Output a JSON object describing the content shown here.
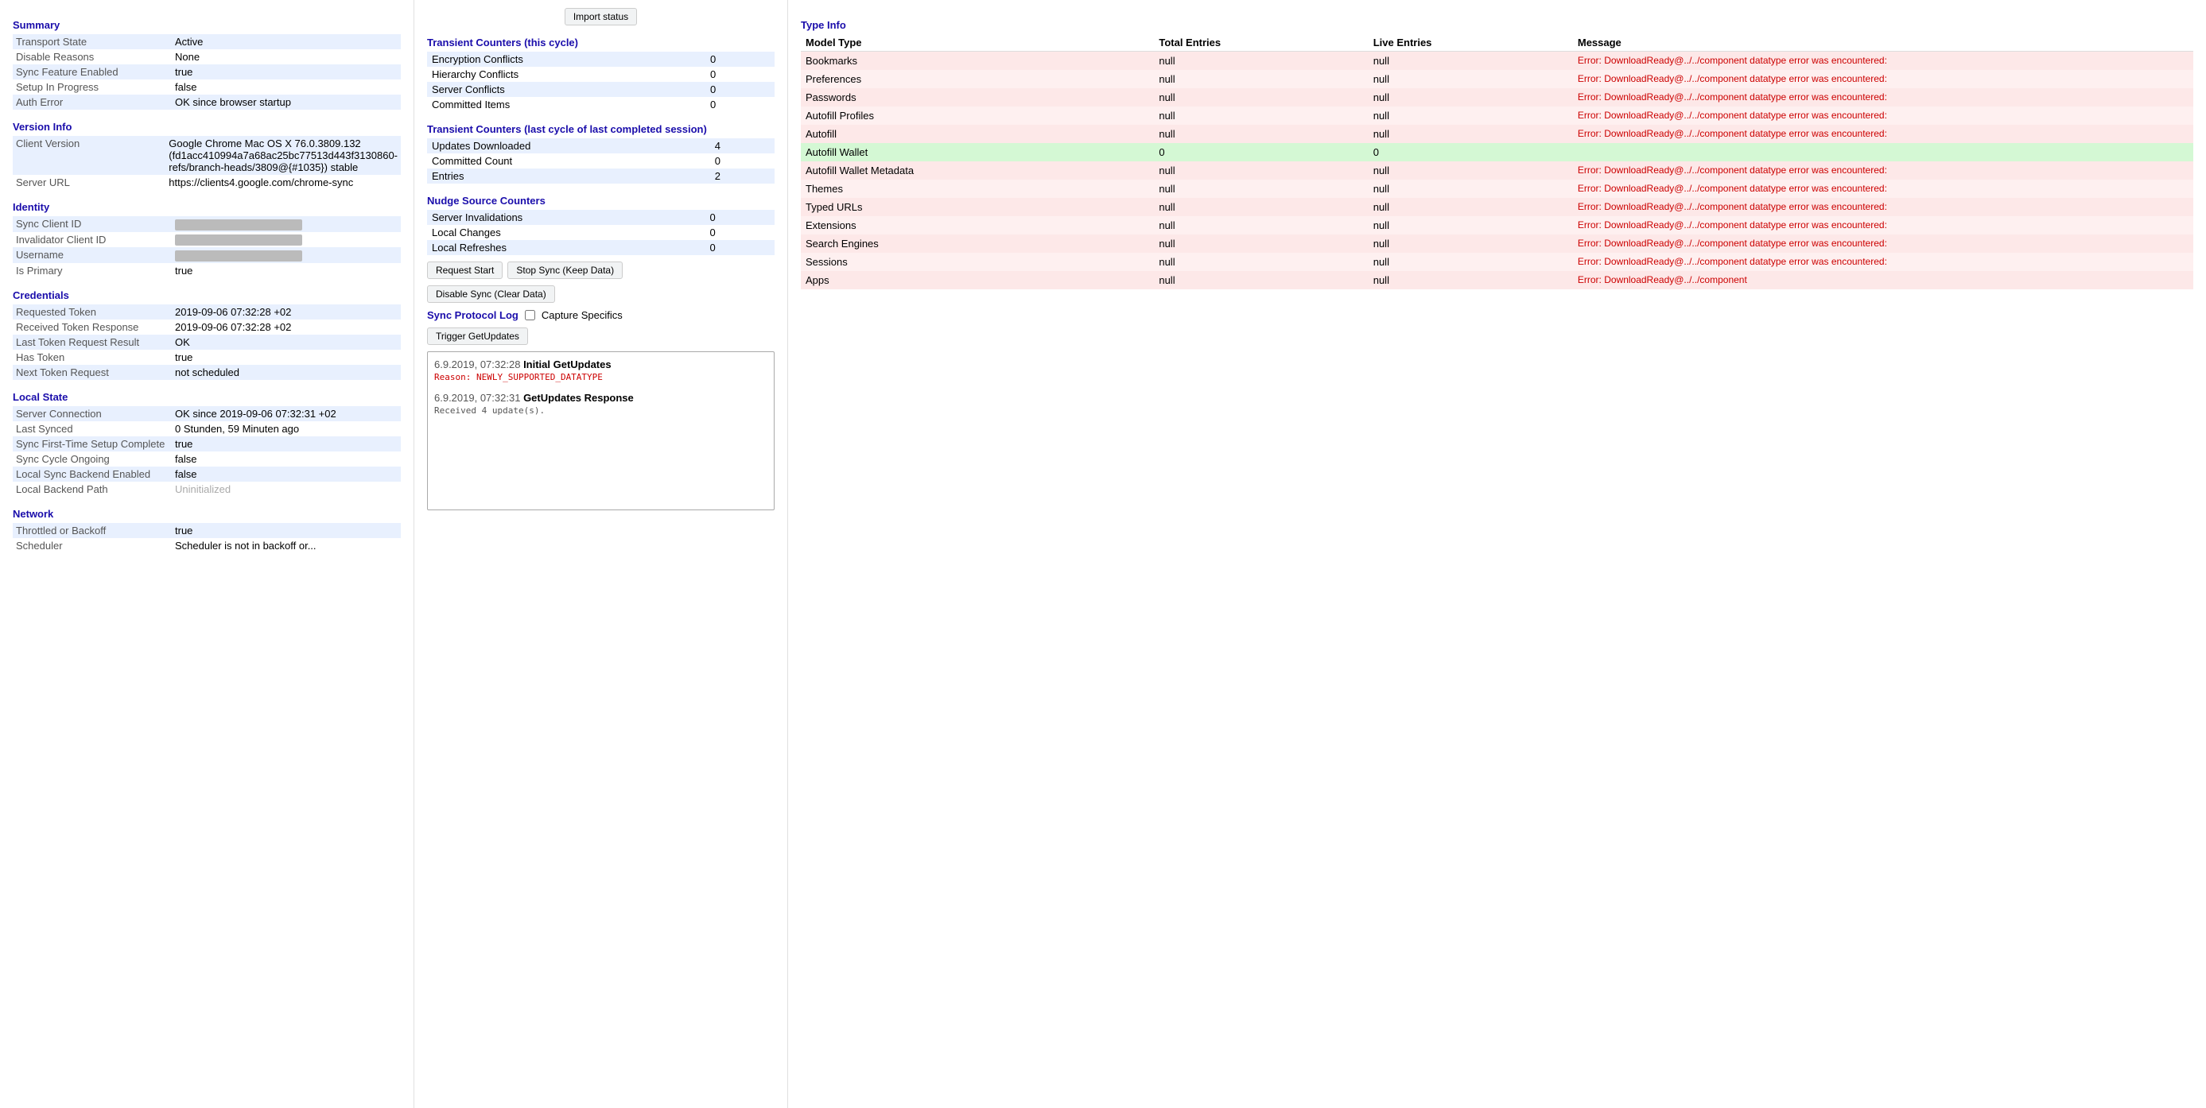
{
  "import_status_btn": "Import status",
  "left": {
    "summary": {
      "title": "Summary",
      "rows": [
        {
          "label": "Transport State",
          "value": "Active"
        },
        {
          "label": "Disable Reasons",
          "value": "None"
        },
        {
          "label": "Sync Feature Enabled",
          "value": "true"
        },
        {
          "label": "Setup In Progress",
          "value": "false"
        },
        {
          "label": "Auth Error",
          "value": "OK since browser startup"
        }
      ]
    },
    "version_info": {
      "title": "Version Info",
      "rows": [
        {
          "label": "Client Version",
          "value": "Google Chrome Mac OS X 76.0.3809.132 (fd1acc410994a7a68ac25bc77513d443f3130860-refs/branch-heads/3809@{#1035}) stable"
        },
        {
          "label": "Server URL",
          "value": "https://clients4.google.com/chrome-sync"
        }
      ]
    },
    "identity": {
      "title": "Identity",
      "rows": [
        {
          "label": "Sync Client ID",
          "value": "BLURRED"
        },
        {
          "label": "Invalidator Client ID",
          "value": "BLURRED"
        },
        {
          "label": "Username",
          "value": "BLURRED"
        },
        {
          "label": "Is Primary",
          "value": "true"
        }
      ]
    },
    "credentials": {
      "title": "Credentials",
      "rows": [
        {
          "label": "Requested Token",
          "value": "2019-09-06 07:32:28 +02"
        },
        {
          "label": "Received Token Response",
          "value": "2019-09-06 07:32:28 +02"
        },
        {
          "label": "Last Token Request Result",
          "value": "OK"
        },
        {
          "label": "Has Token",
          "value": "true"
        },
        {
          "label": "Next Token Request",
          "value": "not scheduled"
        }
      ]
    },
    "local_state": {
      "title": "Local State",
      "rows": [
        {
          "label": "Server Connection",
          "value": "OK since 2019-09-06 07:32:31 +02"
        },
        {
          "label": "Last Synced",
          "value": "0 Stunden, 59 Minuten ago"
        },
        {
          "label": "Sync First-Time Setup Complete",
          "value": "true"
        },
        {
          "label": "Sync Cycle Ongoing",
          "value": "false"
        },
        {
          "label": "Local Sync Backend Enabled",
          "value": "false"
        },
        {
          "label": "Local Backend Path",
          "value": "Uninitialized"
        }
      ]
    },
    "network": {
      "title": "Network",
      "rows": [
        {
          "label": "Throttled or Backoff",
          "value": "true"
        },
        {
          "label": "Scheduler",
          "value": "Scheduler is not in backoff or..."
        }
      ]
    }
  },
  "middle": {
    "transient_counters": {
      "title": "Transient Counters (this cycle)",
      "rows": [
        {
          "label": "Encryption Conflicts",
          "value": "0"
        },
        {
          "label": "Hierarchy Conflicts",
          "value": "0"
        },
        {
          "label": "Server Conflicts",
          "value": "0"
        },
        {
          "label": "Committed Items",
          "value": "0"
        }
      ]
    },
    "transient_counters_last": {
      "title": "Transient Counters (last cycle of last completed session)",
      "rows": [
        {
          "label": "Updates Downloaded",
          "value": "4"
        },
        {
          "label": "Committed Count",
          "value": "0"
        },
        {
          "label": "Entries",
          "value": "2"
        }
      ]
    },
    "nudge_source": {
      "title": "Nudge Source Counters",
      "rows": [
        {
          "label": "Server Invalidations",
          "value": "0"
        },
        {
          "label": "Local Changes",
          "value": "0"
        },
        {
          "label": "Local Refreshes",
          "value": "0"
        }
      ]
    },
    "buttons": {
      "request_start": "Request Start",
      "stop_sync": "Stop Sync (Keep Data)",
      "disable_sync": "Disable Sync (Clear Data)"
    },
    "sync_protocol_log": {
      "title": "Sync Protocol Log",
      "capture_label": "Capture Specifics",
      "trigger_btn": "Trigger GetUpdates",
      "entries": [
        {
          "time": "6.9.2019, 07:32:28",
          "event": "Initial GetUpdates",
          "sub": "Reason: NEWLY_SUPPORTED_DATATYPE",
          "sub_type": "error"
        },
        {
          "time": "6.9.2019, 07:32:31",
          "event": "GetUpdates Response",
          "sub": "Received 4 update(s).",
          "sub_type": "normal"
        }
      ]
    }
  },
  "right": {
    "title": "Type Info",
    "columns": [
      "Model Type",
      "Total Entries",
      "Live Entries",
      "Message"
    ],
    "rows": [
      {
        "type": "Bookmarks",
        "total": "null",
        "live": "null",
        "message": "Error: DownloadReady@../../component datatype error was encountered:",
        "status": "error"
      },
      {
        "type": "Preferences",
        "total": "null",
        "live": "null",
        "message": "Error: DownloadReady@../../component datatype error was encountered:",
        "status": "error"
      },
      {
        "type": "Passwords",
        "total": "null",
        "live": "null",
        "message": "Error: DownloadReady@../../component datatype error was encountered:",
        "status": "error"
      },
      {
        "type": "Autofill Profiles",
        "total": "null",
        "live": "null",
        "message": "Error: DownloadReady@../../component datatype error was encountered:",
        "status": "error"
      },
      {
        "type": "Autofill",
        "total": "null",
        "live": "null",
        "message": "Error: DownloadReady@../../component datatype error was encountered:",
        "status": "error"
      },
      {
        "type": "Autofill Wallet",
        "total": "0",
        "live": "0",
        "message": "",
        "status": "ok"
      },
      {
        "type": "Autofill Wallet Metadata",
        "total": "null",
        "live": "null",
        "message": "Error: DownloadReady@../../component datatype error was encountered:",
        "status": "error"
      },
      {
        "type": "Themes",
        "total": "null",
        "live": "null",
        "message": "Error: DownloadReady@../../component datatype error was encountered:",
        "status": "error"
      },
      {
        "type": "Typed URLs",
        "total": "null",
        "live": "null",
        "message": "Error: DownloadReady@../../component datatype error was encountered:",
        "status": "error"
      },
      {
        "type": "Extensions",
        "total": "null",
        "live": "null",
        "message": "Error: DownloadReady@../../component datatype error was encountered:",
        "status": "error"
      },
      {
        "type": "Search Engines",
        "total": "null",
        "live": "null",
        "message": "Error: DownloadReady@../../component datatype error was encountered:",
        "status": "error"
      },
      {
        "type": "Sessions",
        "total": "null",
        "live": "null",
        "message": "Error: DownloadReady@../../component datatype error was encountered:",
        "status": "error"
      },
      {
        "type": "Apps",
        "total": "null",
        "live": "null",
        "message": "Error: DownloadReady@../../component",
        "status": "error"
      }
    ]
  }
}
